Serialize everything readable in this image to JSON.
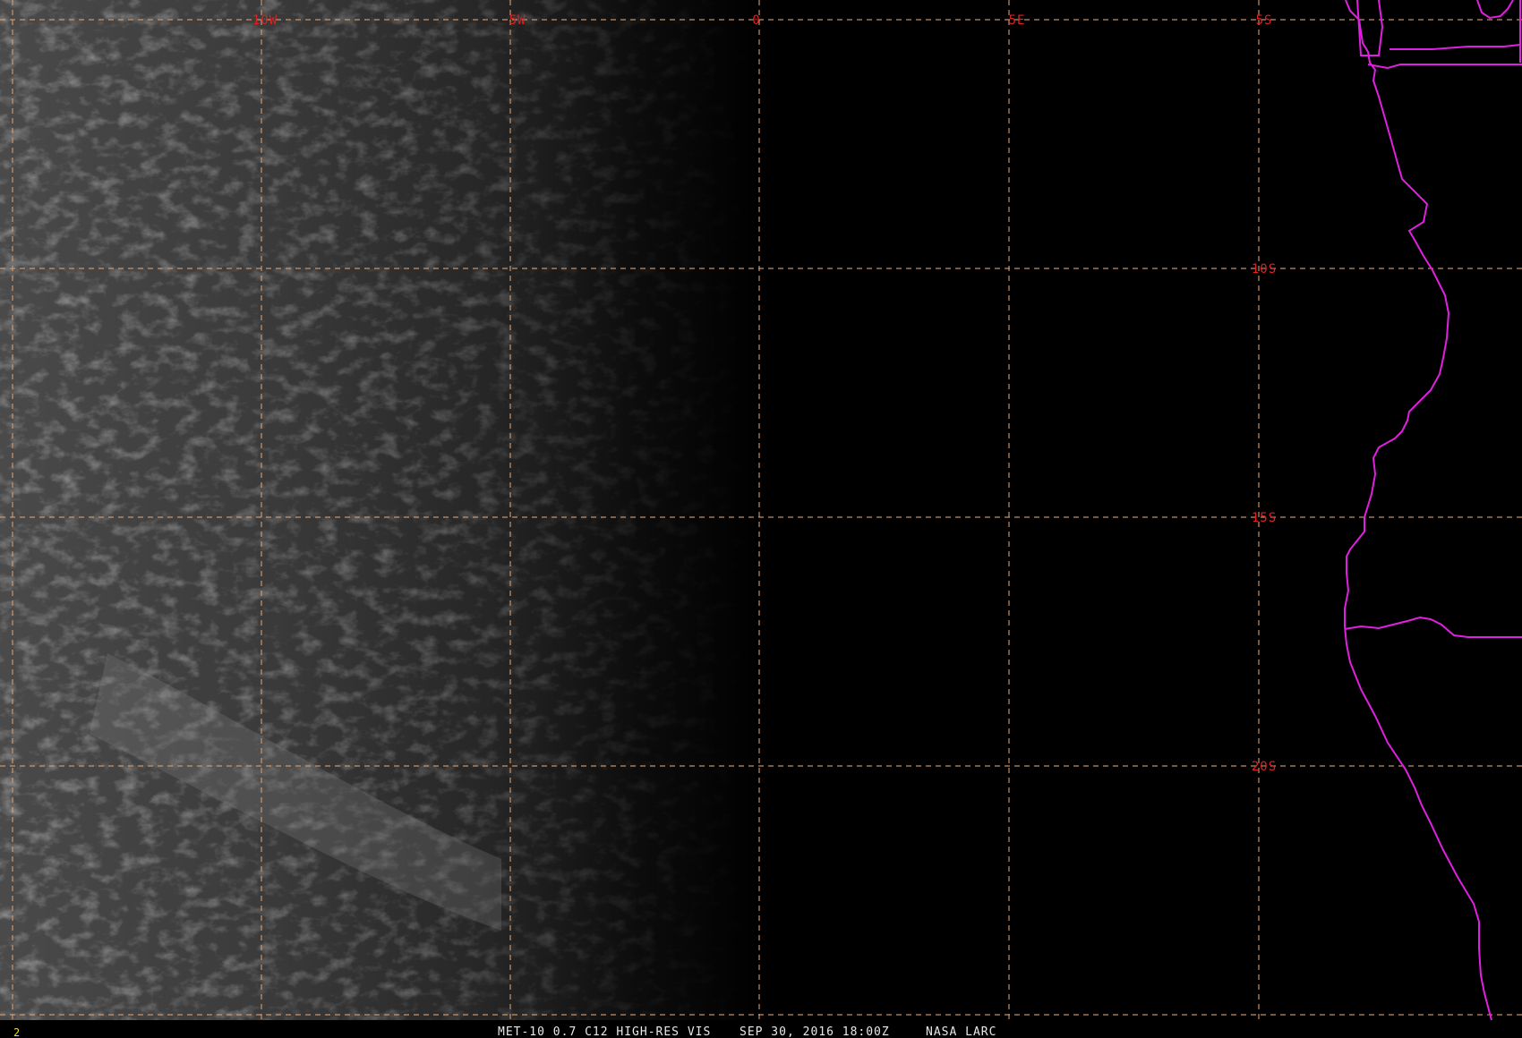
{
  "image": {
    "frame_number": "2",
    "caption": {
      "satellite": "MET-10 0.7 C12 HIGH-RES VIS",
      "datetime": "SEP 30, 2016 18:00Z",
      "source": "NASA LARC"
    }
  },
  "grid": {
    "longitude_labels": [
      "10W",
      "5W",
      "0",
      "5E"
    ],
    "latitude_labels": [
      "5S",
      "10S",
      "15S",
      "20S"
    ]
  },
  "colors": {
    "background": "#000000",
    "grid_line": "#d9a070",
    "grid_label": "#e02020",
    "coastline": "#e020e0",
    "caption_text": "#e8e8e8",
    "frame_number_text": "#e8e020"
  }
}
